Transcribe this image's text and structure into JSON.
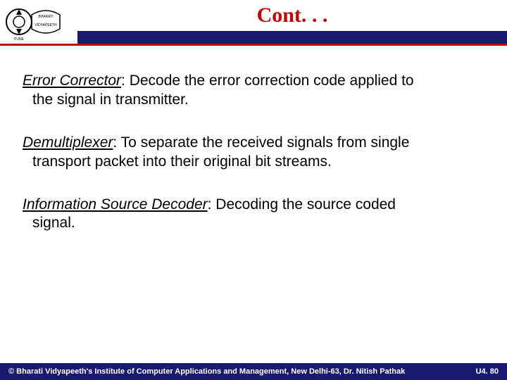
{
  "header": {
    "title": "Cont. . .",
    "logo_alt": "Bharati Vidyapeeth logo"
  },
  "body": {
    "items": [
      {
        "term": "Error Corrector",
        "desc_line1": ": Decode the error correction code applied to",
        "desc_line2": "the signal in transmitter."
      },
      {
        "term": "Demultiplexer",
        "desc_line1": ": To separate the received signals from single",
        "desc_line2": "transport packet into their original bit streams."
      },
      {
        "term": "Information Source Decoder",
        "desc_line1": ": Decoding the source coded",
        "desc_line2": "signal."
      }
    ]
  },
  "footer": {
    "copyright": "© Bharati Vidyapeeth's Institute of Computer Applications and Management, New Delhi-63, Dr. Nitish Pathak",
    "page": "U4. 80"
  }
}
